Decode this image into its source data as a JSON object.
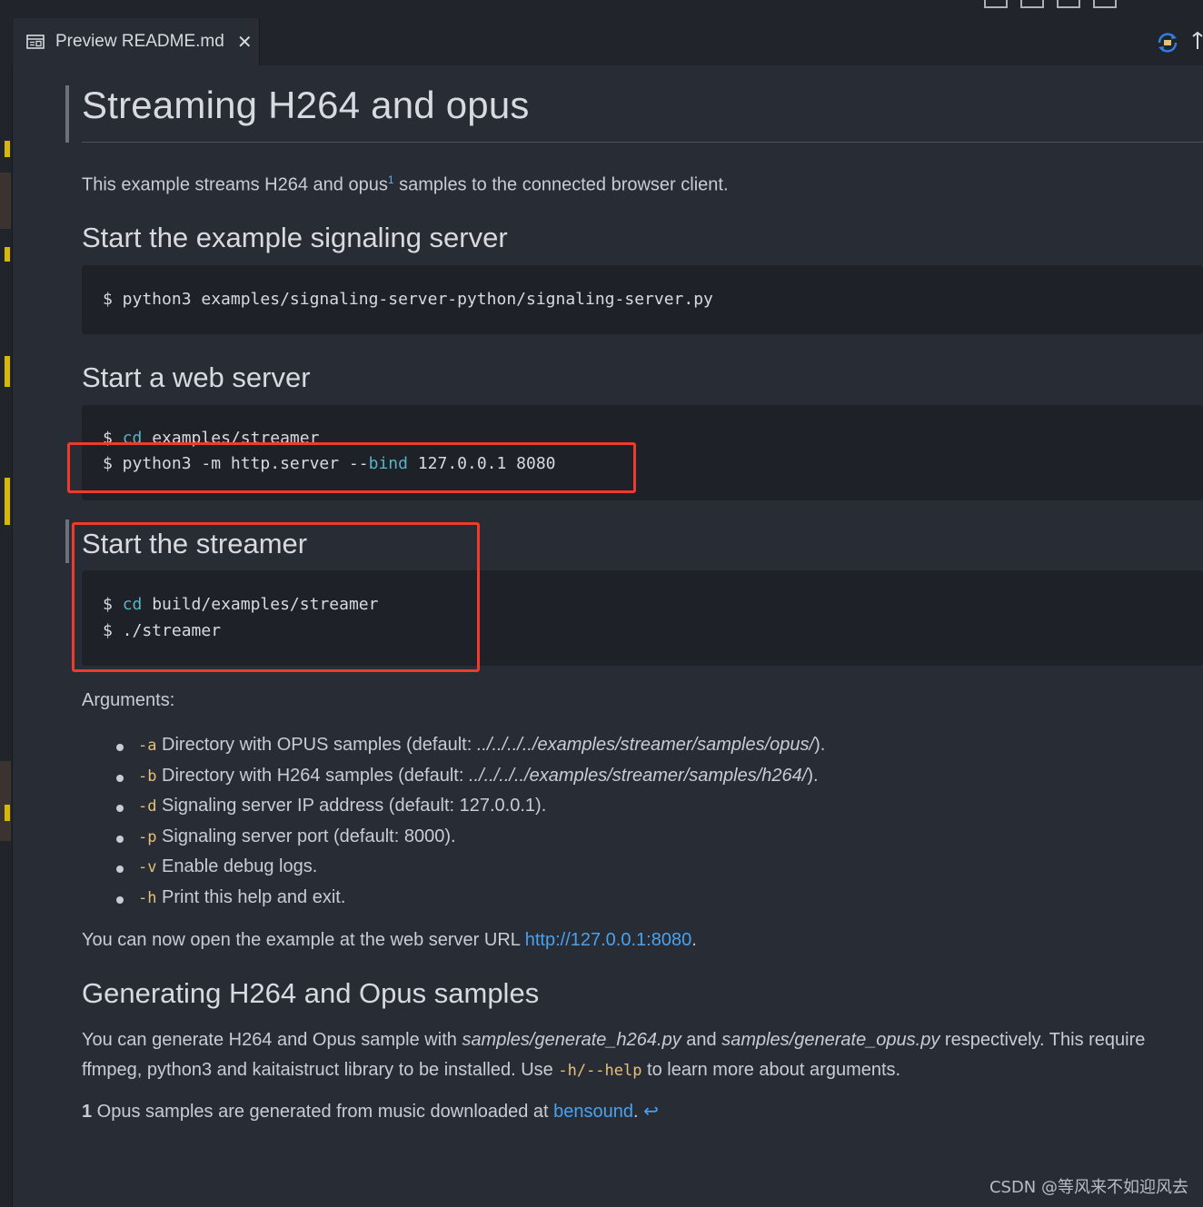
{
  "tab": {
    "title": "Preview README.md",
    "close": "✕"
  },
  "doc": {
    "title": "Streaming H264 and opus",
    "intro_before": "This example streams H264 and opus",
    "intro_sup": "1",
    "intro_after": " samples to the connected browser client.",
    "sections": {
      "signaling": {
        "heading": "Start the example signaling server",
        "code": [
          "$ python3 examples/signaling-server-python/signaling-server.py"
        ]
      },
      "webserver": {
        "heading": "Start a web server",
        "line1_prompt": "$ ",
        "line1_cmd": "cd",
        "line1_rest": " examples/streamer",
        "line2_prefix": "$ python3 -m http.server --",
        "line2_kw": "bind",
        "line2_rest": " 127.0.0.1 8080"
      },
      "streamer": {
        "heading": "Start the streamer",
        "line1_prompt": "$ ",
        "line1_cmd": "cd",
        "line1_rest": " build/examples/streamer",
        "line2": "$ ./streamer"
      }
    },
    "arguments_label": "Arguments:",
    "arguments": [
      {
        "flag": "-a",
        "text": " Directory with OPUS samples (default: ",
        "path": "../../../../examples/streamer/samples/opus/",
        "end": ")."
      },
      {
        "flag": "-b",
        "text": " Directory with H264 samples (default: ",
        "path": "../../../../examples/streamer/samples/h264/",
        "end": ")."
      },
      {
        "flag": "-d",
        "text": " Signaling server IP address (default: 127.0.0.1).",
        "path": "",
        "end": ""
      },
      {
        "flag": "-p",
        "text": " Signaling server port (default: 8000).",
        "path": "",
        "end": ""
      },
      {
        "flag": "-v",
        "text": " Enable debug logs.",
        "path": "",
        "end": ""
      },
      {
        "flag": "-h",
        "text": " Print this help and exit.",
        "path": "",
        "end": ""
      }
    ],
    "open_text": "You can now open the example at the web server URL ",
    "open_link": "http://127.0.0.1:8080",
    "open_end": ".",
    "gen_heading": "Generating H264 and Opus samples",
    "gen_p1": "You can generate H264 and Opus sample with ",
    "gen_path1": "samples/generate_h264.py",
    "gen_p2": " and ",
    "gen_path2": "samples/generate_opus.py",
    "gen_p3": " respectively. This require",
    "gen_line2a": "ffmpeg, python3 and kaitaistruct library to be installed. Use ",
    "gen_code": "-h/--help",
    "gen_line2b": " to learn more about arguments.",
    "footnote_num": "1",
    "footnote_text": " Opus samples are generated from music downloaded at ",
    "footnote_link": "bensound",
    "footnote_end": ". ",
    "footnote_back": "↩"
  },
  "watermark": "CSDN @等风来不如迎风去",
  "colors": {
    "background": "#282c34",
    "code_bg": "#1e2127",
    "highlight_box": "#f03a2e",
    "link": "#4aa1f0",
    "flag": "#e5c07b"
  }
}
